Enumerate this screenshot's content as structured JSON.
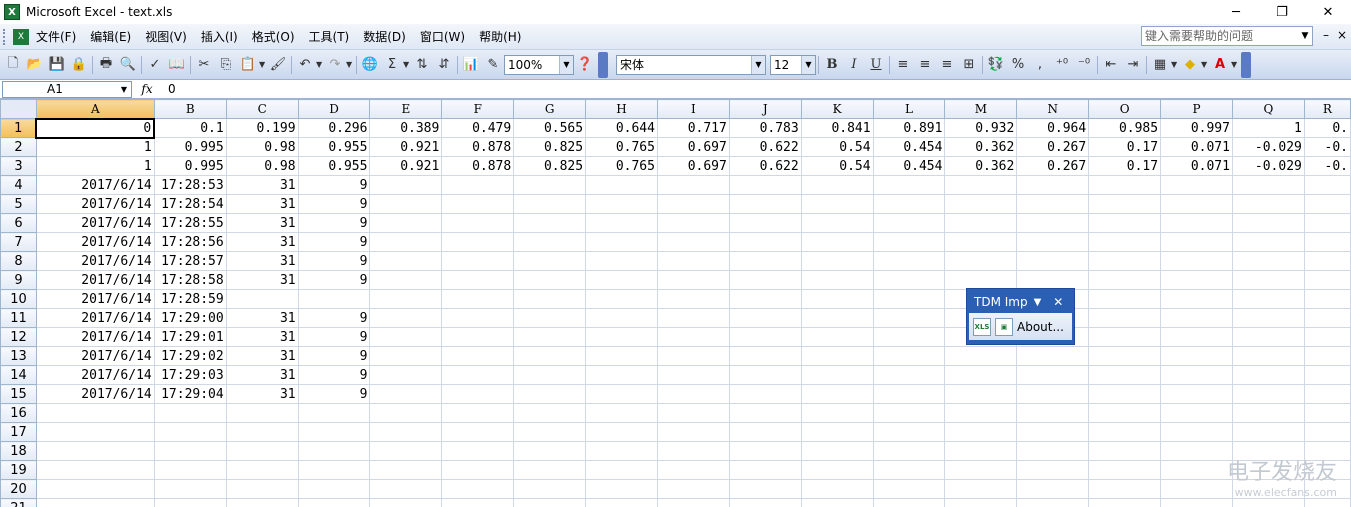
{
  "window": {
    "title": "Microsoft Excel - text.xls",
    "min": "─",
    "restore": "❐",
    "close": "✕"
  },
  "menu": {
    "items": [
      "文件(F)",
      "编辑(E)",
      "视图(V)",
      "插入(I)",
      "格式(O)",
      "工具(T)",
      "数据(D)",
      "窗口(W)",
      "帮助(H)"
    ],
    "help_placeholder": "键入需要帮助的问题"
  },
  "toolbar": {
    "zoom": "100%",
    "font": "宋体",
    "size": "12"
  },
  "formula": {
    "name_box": "A1",
    "fx": "fx",
    "value": "0"
  },
  "columns": [
    "A",
    "B",
    "C",
    "D",
    "E",
    "F",
    "G",
    "H",
    "I",
    "J",
    "K",
    "L",
    "M",
    "N",
    "O",
    "P",
    "Q",
    "R"
  ],
  "rows": [
    [
      "0",
      "0.1",
      "0.199",
      "0.296",
      "0.389",
      "0.479",
      "0.565",
      "0.644",
      "0.717",
      "0.783",
      "0.841",
      "0.891",
      "0.932",
      "0.964",
      "0.985",
      "0.997",
      "1",
      "0."
    ],
    [
      "1",
      "0.995",
      "0.98",
      "0.955",
      "0.921",
      "0.878",
      "0.825",
      "0.765",
      "0.697",
      "0.622",
      "0.54",
      "0.454",
      "0.362",
      "0.267",
      "0.17",
      "0.071",
      "-0.029",
      "-0."
    ],
    [
      "1",
      "0.995",
      "0.98",
      "0.955",
      "0.921",
      "0.878",
      "0.825",
      "0.765",
      "0.697",
      "0.622",
      "0.54",
      "0.454",
      "0.362",
      "0.267",
      "0.17",
      "0.071",
      "-0.029",
      "-0."
    ],
    [
      "2017/6/14",
      "17:28:53",
      "31",
      "9",
      "",
      "",
      "",
      "",
      "",
      "",
      "",
      "",
      "",
      "",
      "",
      "",
      "",
      ""
    ],
    [
      "2017/6/14",
      "17:28:54",
      "31",
      "9",
      "",
      "",
      "",
      "",
      "",
      "",
      "",
      "",
      "",
      "",
      "",
      "",
      "",
      ""
    ],
    [
      "2017/6/14",
      "17:28:55",
      "31",
      "9",
      "",
      "",
      "",
      "",
      "",
      "",
      "",
      "",
      "",
      "",
      "",
      "",
      "",
      ""
    ],
    [
      "2017/6/14",
      "17:28:56",
      "31",
      "9",
      "",
      "",
      "",
      "",
      "",
      "",
      "",
      "",
      "",
      "",
      "",
      "",
      "",
      ""
    ],
    [
      "2017/6/14",
      "17:28:57",
      "31",
      "9",
      "",
      "",
      "",
      "",
      "",
      "",
      "",
      "",
      "",
      "",
      "",
      "",
      "",
      ""
    ],
    [
      "2017/6/14",
      "17:28:58",
      "31",
      "9",
      "",
      "",
      "",
      "",
      "",
      "",
      "",
      "",
      "",
      "",
      "",
      "",
      "",
      ""
    ],
    [
      "2017/6/14",
      "17:28:59",
      "",
      "",
      "",
      "",
      "",
      "",
      "",
      "",
      "",
      "",
      "",
      "",
      "",
      "",
      "",
      ""
    ],
    [
      "2017/6/14",
      "17:29:00",
      "31",
      "9",
      "",
      "",
      "",
      "",
      "",
      "",
      "",
      "",
      "",
      "",
      "",
      "",
      "",
      ""
    ],
    [
      "2017/6/14",
      "17:29:01",
      "31",
      "9",
      "",
      "",
      "",
      "",
      "",
      "",
      "",
      "",
      "",
      "",
      "",
      "",
      "",
      ""
    ],
    [
      "2017/6/14",
      "17:29:02",
      "31",
      "9",
      "",
      "",
      "",
      "",
      "",
      "",
      "",
      "",
      "",
      "",
      "",
      "",
      "",
      ""
    ],
    [
      "2017/6/14",
      "17:29:03",
      "31",
      "9",
      "",
      "",
      "",
      "",
      "",
      "",
      "",
      "",
      "",
      "",
      "",
      "",
      "",
      ""
    ],
    [
      "2017/6/14",
      "17:29:04",
      "31",
      "9",
      "",
      "",
      "",
      "",
      "",
      "",
      "",
      "",
      "",
      "",
      "",
      "",
      "",
      ""
    ],
    [
      "",
      "",
      "",
      "",
      "",
      "",
      "",
      "",
      "",
      "",
      "",
      "",
      "",
      "",
      "",
      "",
      "",
      ""
    ],
    [
      "",
      "",
      "",
      "",
      "",
      "",
      "",
      "",
      "",
      "",
      "",
      "",
      "",
      "",
      "",
      "",
      "",
      ""
    ],
    [
      "",
      "",
      "",
      "",
      "",
      "",
      "",
      "",
      "",
      "",
      "",
      "",
      "",
      "",
      "",
      "",
      "",
      ""
    ],
    [
      "",
      "",
      "",
      "",
      "",
      "",
      "",
      "",
      "",
      "",
      "",
      "",
      "",
      "",
      "",
      "",
      "",
      ""
    ],
    [
      "",
      "",
      "",
      "",
      "",
      "",
      "",
      "",
      "",
      "",
      "",
      "",
      "",
      "",
      "",
      "",
      "",
      ""
    ],
    [
      "",
      "",
      "",
      "",
      "",
      "",
      "",
      "",
      "",
      "",
      "",
      "",
      "",
      "",
      "",
      "",
      "",
      ""
    ]
  ],
  "float_toolbar": {
    "title": "TDM Imp",
    "close": "✕",
    "xls_label": "XLS",
    "about": "About..."
  },
  "watermark": {
    "brand": "电子发烧友",
    "url": "www.elecfans.com"
  }
}
